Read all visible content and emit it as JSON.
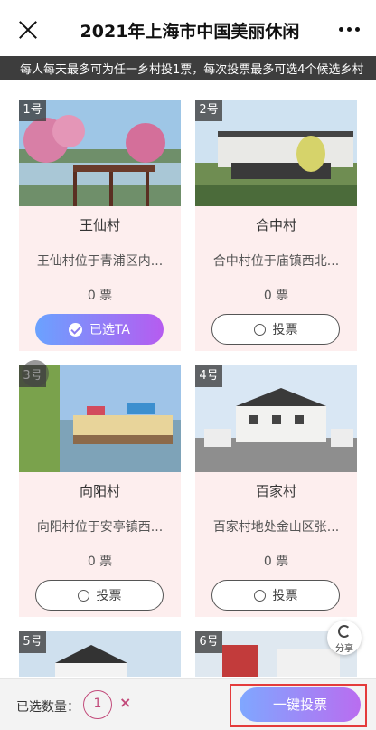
{
  "header": {
    "title": "2021年上海市中国美丽休闲",
    "close_icon": "close-icon",
    "more_icon": "more-icon"
  },
  "notice": "每人每天最多可为任一乡村投1票，每次投票最多可选4个候选乡村",
  "cards": [
    {
      "num": "1号",
      "name": "王仙村",
      "desc": "王仙村位于青浦区内...",
      "votes": "0 票",
      "button": "已选TA",
      "selected": true
    },
    {
      "num": "2号",
      "name": "合中村",
      "desc": "合中村位于庙镇西北...",
      "votes": "0 票",
      "button": "投票",
      "selected": false
    },
    {
      "num": "3号",
      "name": "向阳村",
      "desc": "向阳村位于安亭镇西...",
      "votes": "0 票",
      "button": "投票",
      "selected": false
    },
    {
      "num": "4号",
      "name": "百家村",
      "desc": "百家村地处金山区张...",
      "votes": "0 票",
      "button": "投票",
      "selected": false
    },
    {
      "num": "5号"
    },
    {
      "num": "6号"
    }
  ],
  "share": {
    "label": "分享",
    "icon": "share-icon"
  },
  "footer": {
    "selected_label": "已选数量：",
    "selected_count": "1",
    "clear_icon": "×",
    "vote_all": "一键投票"
  },
  "colors": {
    "card_bg": "#fdeeee",
    "accent_start": "#6aa2ff",
    "accent_end": "#b65cf0",
    "highlight": "#e43b3b"
  }
}
